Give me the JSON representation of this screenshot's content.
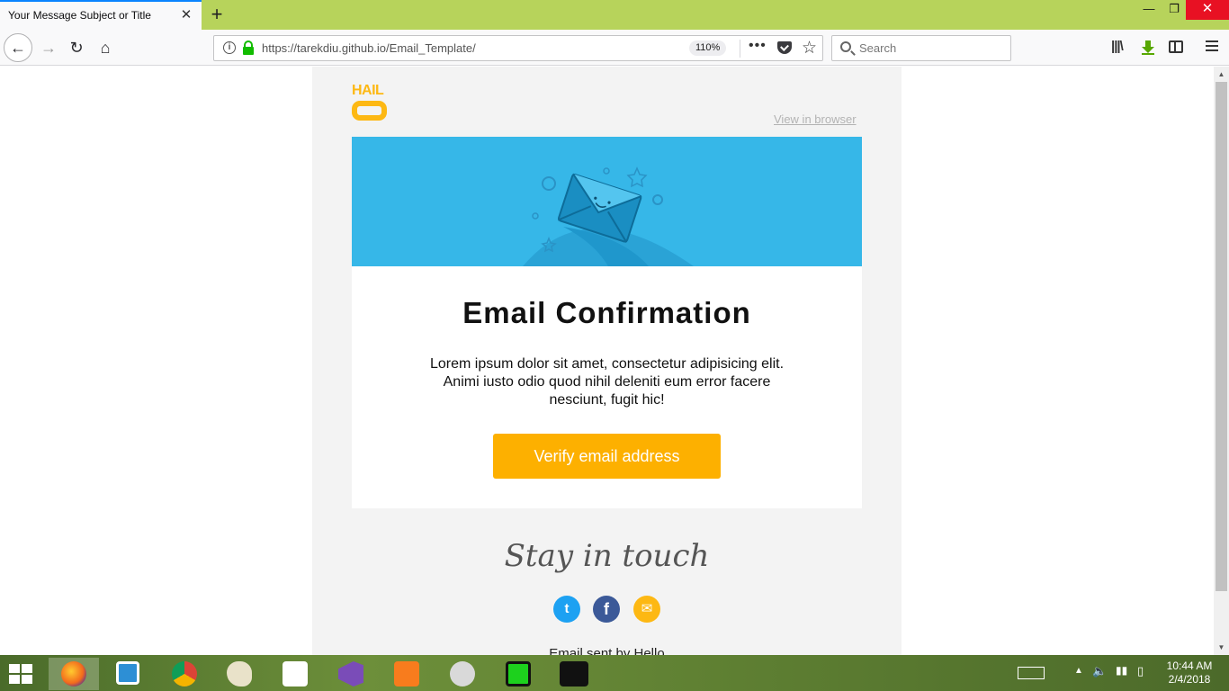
{
  "browser": {
    "tab_title": "Your Message Subject or Title",
    "close_tab": "✕",
    "new_tab": "+",
    "url": "https://tarekdiu.github.io/Email_Template/",
    "zoom": "110%",
    "more_actions": "•••",
    "search_placeholder": "Search",
    "window_controls": {
      "minimize": "—",
      "restore": "❐",
      "close": "✕"
    }
  },
  "email": {
    "logo_text": "HAIL",
    "view_in_browser": "View in browser",
    "title": "Email Confirmation",
    "body": "Lorem ipsum dolor sit amet, consectetur adipisicing elit. Animi iusto odio quod nihil deleniti eum error facere nesciunt, fugit hic!",
    "verify_button": "Verify email address",
    "stay_in_touch": "Stay in touch",
    "footer": "Email sent by Hello",
    "social": [
      {
        "name": "twitter-icon",
        "glyph": "t"
      },
      {
        "name": "facebook-icon",
        "glyph": "f"
      },
      {
        "name": "mail-icon",
        "glyph": "✉"
      }
    ],
    "colors": {
      "hero": "#36b7e8",
      "accent": "#fdb000",
      "background": "#f3f3f3"
    }
  },
  "taskbar": {
    "time": "10:44 AM",
    "date": "2/4/2018",
    "apps": [
      "firefox",
      "windows-apps",
      "chrome",
      "paint",
      "screen-capture",
      "visual-studio",
      "xampp",
      "snipping-tool",
      "emulator",
      "flash"
    ]
  }
}
